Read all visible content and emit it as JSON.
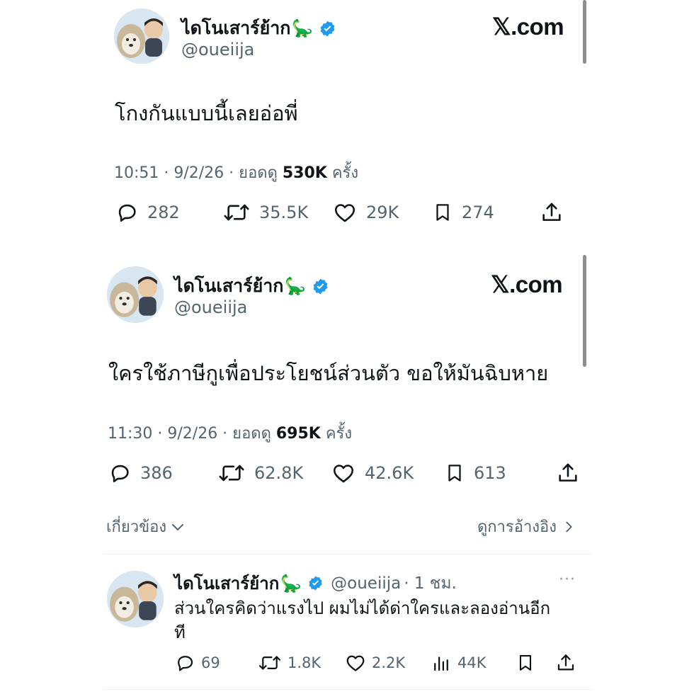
{
  "tweets": [
    {
      "user": {
        "name": "ไดโนเสาร์ย้าก",
        "emoji": "🦕",
        "handle": "@oueiija"
      },
      "brand": "𝕏.com",
      "text": "โกงกันแบบนี้เลยอ่อพี่",
      "time": "10:51 · 9/2/26 · ยอดดู ",
      "views": "530K",
      "views_suffix": " ครั้ง",
      "stats": {
        "replies": "282",
        "retweets": "35.5K",
        "likes": "29K",
        "bookmarks": "274"
      }
    },
    {
      "user": {
        "name": "ไดโนเสาร์ย้าก",
        "emoji": "🦕",
        "handle": "@oueiija"
      },
      "brand": "𝕏.com",
      "text": "ใครใช้ภาษีกูเพื่อประโยชน์ส่วนตัว ขอให้มันฉิบหาย",
      "time": "11:30 · 9/2/26 · ยอดดู ",
      "views": "695K",
      "views_suffix": " ครั้ง",
      "stats": {
        "replies": "386",
        "retweets": "62.8K",
        "likes": "42.6K",
        "bookmarks": "613"
      }
    }
  ],
  "related": {
    "left_label": "เกี่ยวข้อง",
    "right_label": "ดูการอ้างอิง"
  },
  "reply": {
    "name": "ไดโนเสาร์ย้าก",
    "emoji": "🦕",
    "handle": "@oueiija",
    "time": "· 1 ชม.",
    "more": "···",
    "text_line1": "ส่วนใครคิดว่าแรงไป ผมไม่ได้ด่าใครและลองอ่านอีก",
    "text_line2": "ที",
    "stats": {
      "replies": "69",
      "retweets": "1.8K",
      "likes": "2.2K",
      "views": "44K"
    }
  },
  "colors": {
    "verified": "#1d9bf0",
    "muted": "#536471",
    "text": "#0f1419"
  }
}
